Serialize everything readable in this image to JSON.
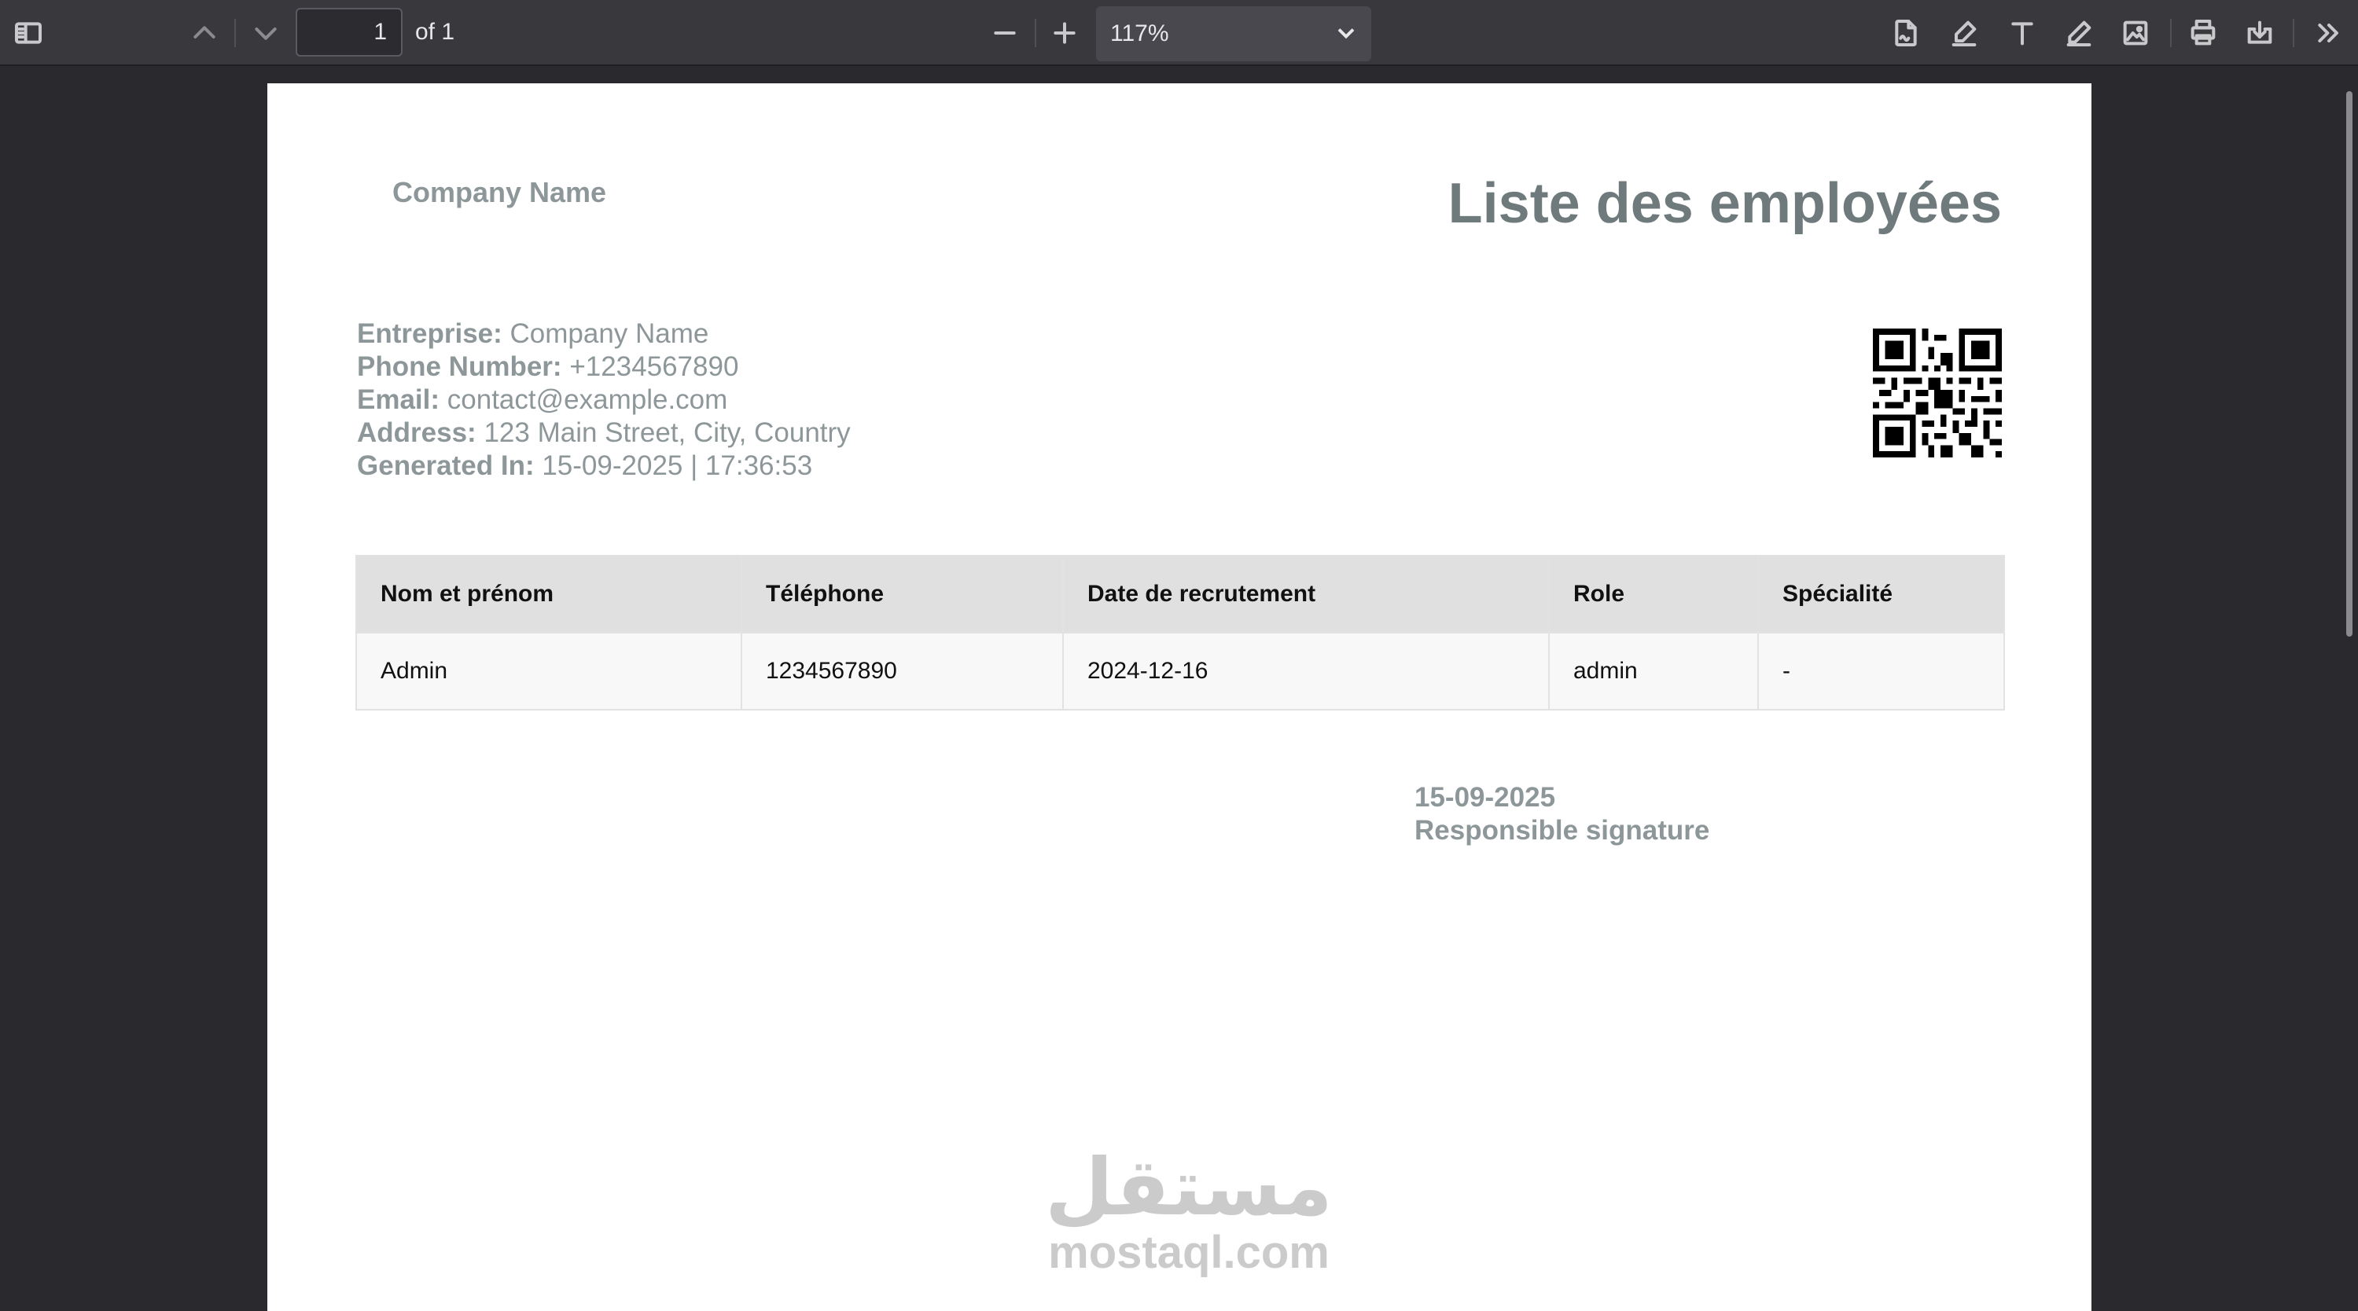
{
  "toolbar": {
    "page_current": "1",
    "page_total_label": "of 1",
    "zoom_value": "117%",
    "icons": [
      "sidebar-toggle-icon",
      "chevron-up-icon",
      "chevron-down-icon",
      "minus-icon",
      "plus-icon",
      "chevron-down-icon",
      "edit-signature-icon",
      "highlight-icon",
      "text-icon",
      "draw-icon",
      "image-icon",
      "print-icon",
      "download-icon",
      "more-tools-icon"
    ]
  },
  "document": {
    "company_logo_text": "Company Name",
    "title": "Liste des employées",
    "info": [
      {
        "label": "Entreprise:",
        "value": "Company Name"
      },
      {
        "label": "Phone Number:",
        "value": "+1234567890"
      },
      {
        "label": "Email:",
        "value": "contact@example.com"
      },
      {
        "label": "Address:",
        "value": "123 Main Street, City, Country"
      },
      {
        "label": "Generated In:",
        "value": "15-09-2025 | 17:36:53"
      }
    ],
    "table": {
      "headers": [
        "Nom et prénom",
        "Téléphone",
        "Date de recrutement",
        "Role",
        "Spécialité"
      ],
      "rows": [
        [
          "Admin",
          "1234567890",
          "2024-12-16",
          "admin",
          "-"
        ]
      ]
    },
    "signature_date": "15-09-2025",
    "signature_label": "Responsible signature",
    "watermark_arabic": "مستقل",
    "watermark_latin": "mostaql.com"
  }
}
